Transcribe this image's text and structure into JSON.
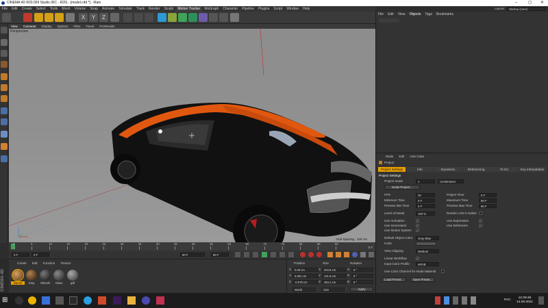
{
  "window": {
    "title": "CINEMA 4D R20.059 Studio (RC - R20) - [model.c4d *] - Main",
    "layout_label": "Layout:",
    "layout_value": "Startup (User)"
  },
  "menubar": {
    "items": [
      "File",
      "Edit",
      "Create",
      "Select",
      "Tools",
      "Mesh",
      "Volume",
      "Snap",
      "Animate",
      "Simulate",
      "Track",
      "Render",
      "Sculpt",
      "Motion Tracker",
      "MoGraph",
      "Character",
      "Pipeline",
      "Plugins",
      "Script",
      "Window",
      "Help"
    ],
    "highlighted": "Motion Tracker"
  },
  "viewport": {
    "menu": [
      "View",
      "Cameras",
      "Display",
      "Options",
      "Filter",
      "Panel",
      "ProRender"
    ],
    "label": "Perspective",
    "grid_spacing": "Grid Spacing : 100 cm"
  },
  "timeline": {
    "ticks": [
      "0",
      "5",
      "10",
      "15",
      "20",
      "25",
      "30",
      "35",
      "40",
      "45",
      "50",
      "55",
      "60",
      "65",
      "70",
      "75",
      "80",
      "85",
      "90"
    ],
    "end_label": "0 F",
    "start_field": "0 F",
    "cur_field": "0 F",
    "end_field": "90 F",
    "end_field2": "90 F"
  },
  "materials": {
    "menu": [
      "Create",
      "Edit",
      "Function",
      "Texture"
    ],
    "items": [
      "interior",
      "Gray",
      "Wheels",
      "Glass",
      "grill"
    ],
    "side_label": "CINEMA 4D"
  },
  "coords": {
    "headers": [
      "Position",
      "Size",
      "Rotation"
    ],
    "rows": [
      {
        "axis": "X",
        "pos": "0.05 cm",
        "size": "204.8 cm",
        "rot_label": "H",
        "rot": "0 °"
      },
      {
        "axis": "Y",
        "pos": "0.351 cm",
        "size": "121.9 cm",
        "rot_label": "P",
        "rot": "0 °"
      },
      {
        "axis": "Z",
        "pos": "-0.079 cm",
        "size": "454.1 cm",
        "rot_label": "B",
        "rot": "0 °"
      }
    ],
    "mode1": "World",
    "mode2": "Size",
    "apply": "Apply"
  },
  "objects": {
    "menu": [
      "File",
      "Edit",
      "View",
      "Objects",
      "Tags",
      "Bookmarks"
    ],
    "active": "Objects"
  },
  "attributes": {
    "menu": [
      "Mode",
      "Edit",
      "User Data"
    ],
    "title": "Project",
    "tabs": [
      "Project Settings",
      "Info",
      "Dynamics",
      "Referencing",
      "To Do",
      "Key Interpolation"
    ],
    "section": "Project Settings",
    "project_scale_label": "Project Scale",
    "project_scale_value": "1",
    "project_scale_unit": "Centimeters",
    "scale_button": "Scale Project...",
    "fps_label": "FPS",
    "fps_value": "30",
    "project_time_label": "Project Time",
    "project_time_value": "0 F",
    "min_time_label": "Minimum Time",
    "min_time_value": "0 F",
    "max_time_label": "Maximum Time",
    "max_time_value": "90 F",
    "prev_min_label": "Preview Min Time",
    "prev_min_value": "0 F",
    "prev_max_label": "Preview Max Time",
    "prev_max_value": "90 F",
    "lod_label": "Level of Detail",
    "lod_value": "100 %",
    "render_lod_label": "Render LOD in Editor",
    "use_animation": "Use Animation",
    "use_expression": "Use Expression",
    "use_generators": "Use Generators",
    "use_deformers": "Use Deformers",
    "use_motion_system": "Use Motion System",
    "default_color_label": "Default Object Color",
    "default_color_value": "Gray-Blue",
    "color_label": "Color",
    "view_clipping_label": "View Clipping",
    "view_clipping_value": "Medium",
    "linear_workflow": "Linear Workflow",
    "input_color_label": "Input Color Profile",
    "input_color_value": "sRGB",
    "use_color_channel": "Use Color Channel for Node Material",
    "load_preset": "Load Preset...",
    "save_preset": "Save Preset..."
  },
  "clock": {
    "time": "12:39:48",
    "date": "14.09.2021",
    "lang": "РУС"
  },
  "colors": {
    "accent": "#e8a000",
    "car_orange": "#e0580f"
  }
}
